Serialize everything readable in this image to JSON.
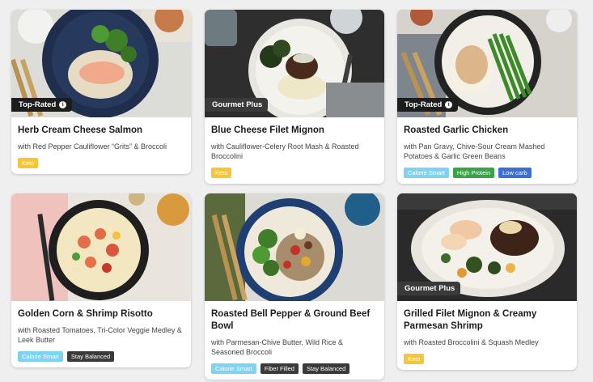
{
  "colors": {
    "keto": "#f6c538",
    "calorie_smart": "#7fd3f1",
    "high_protein": "#3aa34a",
    "low_carb": "#3b6fd1",
    "dark_tag": "#3a3a3a"
  },
  "meals": [
    {
      "badge": "Top-Rated",
      "badge_icon": "info-icon",
      "title": "Herb Cream Cheese Salmon",
      "subtitle": "with Red Pepper Cauliflower “Grits” & Broccoli",
      "tags": [
        "Keto"
      ]
    },
    {
      "badge": "Gourmet Plus",
      "title": "Blue Cheese Filet Mignon",
      "subtitle": "with Cauliflower-Celery Root Mash & Roasted Broccolini",
      "tags": [
        "Keto"
      ]
    },
    {
      "badge": "Top-Rated",
      "badge_icon": "info-icon",
      "title": "Roasted Garlic Chicken",
      "subtitle": "with Pan Gravy, Chive-Sour Cream Mashed Potatoes & Garlic Green Beans",
      "tags": [
        "Calorie Smart",
        "High Protein",
        "Low carb"
      ]
    },
    {
      "badge": "",
      "title": "Golden Corn & Shrimp Risotto",
      "subtitle": "with Roasted Tomatoes, Tri-Color Veggie Medley & Leek Butter",
      "tags": [
        "Calorie Smart",
        "Stay Balanced"
      ]
    },
    {
      "badge": "",
      "title": "Roasted Bell Pepper & Ground Beef Bowl",
      "subtitle": "with Parmesan-Chive Butter, Wild Rice & Seasoned Broccoli",
      "tags": [
        "Calorie Smart",
        "Fiber Filled",
        "Stay Balanced"
      ]
    },
    {
      "badge": "Gourmet Plus",
      "title": "Grilled Filet Mignon & Creamy Parmesan Shrimp",
      "subtitle": "with Roasted Broccolini & Squash Medley",
      "tags": [
        "Keto"
      ]
    }
  ]
}
